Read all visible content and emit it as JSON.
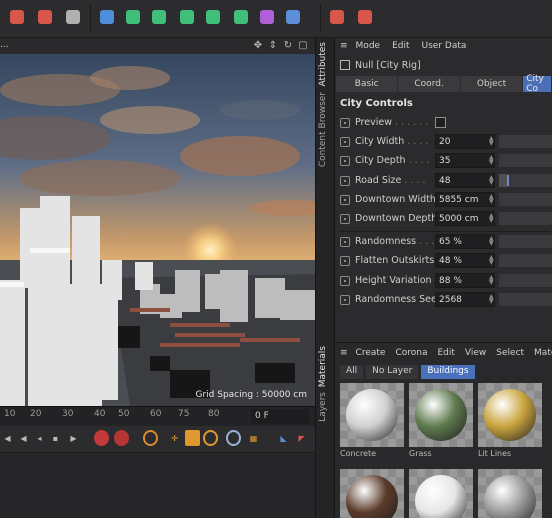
{
  "toolbar": {
    "buttons": [
      {
        "icon": "render-region-icon",
        "color": "#d9574a"
      },
      {
        "icon": "render-view-icon",
        "color": "#d9574a"
      },
      {
        "icon": "render-settings-icon",
        "color": "#b0b0b0"
      },
      {
        "icon": "cube-icon",
        "color": "#4f8ed8"
      },
      {
        "icon": "pen-spline-icon",
        "color": "#3fbf7a"
      },
      {
        "icon": "subdivision-icon",
        "color": "#3fbf7a"
      },
      {
        "icon": "extrude-generator-icon",
        "color": "#3fbf7a"
      },
      {
        "icon": "cloner-icon",
        "color": "#3fbf7a"
      },
      {
        "icon": "array-icon",
        "color": "#3fbf7a"
      },
      {
        "icon": "deformer-icon",
        "color": "#b05fd8"
      },
      {
        "icon": "scene-icon",
        "color": "#5d8ed8"
      },
      {
        "icon": "camera-icon",
        "color": "#d9574a"
      },
      {
        "icon": "light-icon",
        "color": "#d9574a"
      }
    ]
  },
  "viewport": {
    "view_label": "...",
    "grid_spacing": "Grid Spacing : 50000 cm"
  },
  "timeline": {
    "ticks": [
      "10",
      "20",
      "30",
      "40",
      "50",
      "60",
      "75",
      "80"
    ],
    "frame": "0 F"
  },
  "side_tabs": {
    "attributes": "Attributes",
    "content_browser": "Content Browser",
    "materials": "Materials",
    "layers": "Layers"
  },
  "attributes": {
    "menu": [
      "Mode",
      "Edit",
      "User Data"
    ],
    "object_name": "Null [City Rig]",
    "tabs": [
      "Basic",
      "Coord.",
      "Object",
      "City Co"
    ],
    "active_tab": "City Co",
    "section_title": "City Controls",
    "preview_label": "Preview",
    "params_a": [
      {
        "label": "City Width",
        "value": "20",
        "fill": 0.0
      },
      {
        "label": "City Depth",
        "value": "35",
        "fill": 0.0
      },
      {
        "label": "Road Size",
        "value": "48",
        "fill": 0.15
      },
      {
        "label": "Downtown Width",
        "value": "5855 cm",
        "fill": 0.0
      },
      {
        "label": "Downtown Depth",
        "value": "5000 cm",
        "fill": 0.0
      }
    ],
    "params_b": [
      {
        "label": "Randomness",
        "value": "65 %",
        "fill": 0.0
      },
      {
        "label": "Flatten Outskirts",
        "value": "48 %",
        "fill": 0.0
      },
      {
        "label": "Height Variation",
        "value": "88 %",
        "fill": 0.0
      },
      {
        "label": "Randomness Seed",
        "value": "2568",
        "fill": 0.0
      }
    ]
  },
  "materials": {
    "menu": [
      "Create",
      "Corona",
      "Edit",
      "View",
      "Select",
      "Mate"
    ],
    "filters": [
      "All",
      "No Layer",
      "Buildings"
    ],
    "active_filter": "Buildings",
    "items": [
      {
        "name": "Concrete",
        "color": "#d0d0d0"
      },
      {
        "name": "Grass",
        "color": "#5e7a4e"
      },
      {
        "name": "Lit Lines",
        "color": "#c9a43d"
      },
      {
        "name": "",
        "color": "#5a3a2a"
      },
      {
        "name": "",
        "color": "#e6e6e6"
      },
      {
        "name": "",
        "color": "#9a9a9a"
      }
    ]
  }
}
